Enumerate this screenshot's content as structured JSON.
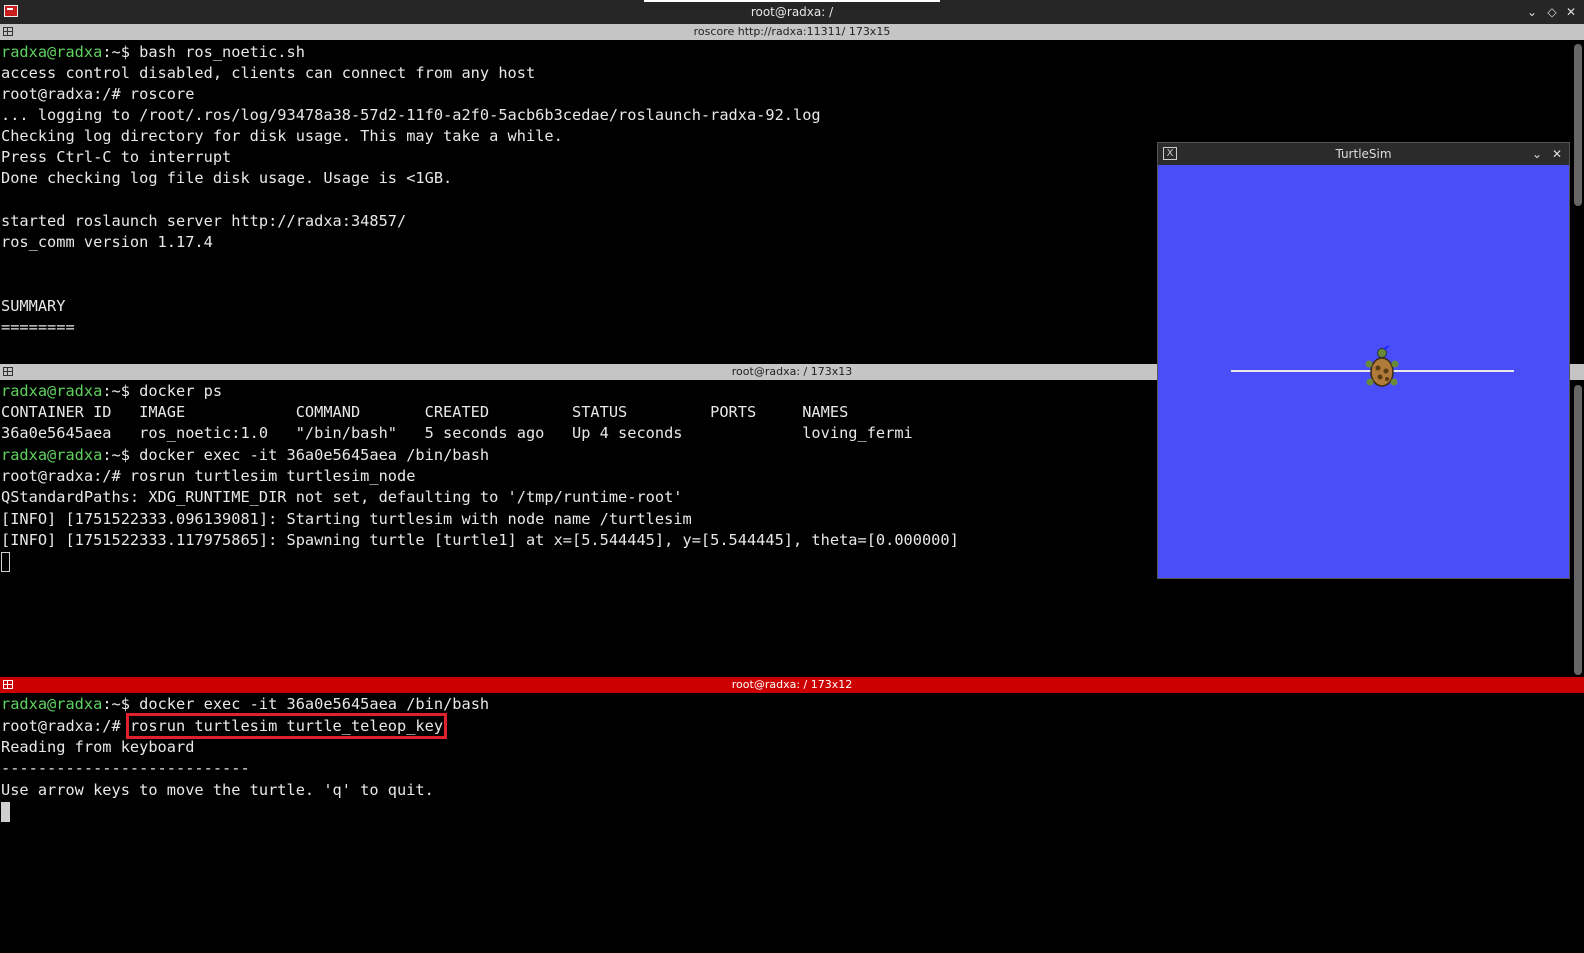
{
  "window": {
    "title": "root@radxa: /",
    "min_icon": "chevron-down-icon",
    "max_icon": "diamond-icon",
    "close_icon": "close-icon"
  },
  "panes": [
    {
      "title": "roscore http://radxa:11311/ 173x15",
      "lines": [
        {
          "user": "radxa@radxa",
          "rest": ":~$ bash ros_noetic.sh"
        },
        {
          "text": "access control disabled, clients can connect from any host"
        },
        {
          "text": "root@radxa:/# roscore"
        },
        {
          "text": "... logging to /root/.ros/log/93478a38-57d2-11f0-a2f0-5acb6b3cedae/roslaunch-radxa-92.log"
        },
        {
          "text": "Checking log directory for disk usage. This may take a while."
        },
        {
          "text": "Press Ctrl-C to interrupt"
        },
        {
          "text": "Done checking log file disk usage. Usage is <1GB."
        },
        {
          "text": ""
        },
        {
          "text": "started roslaunch server http://radxa:34857/"
        },
        {
          "text": "ros_comm version 1.17.4"
        },
        {
          "text": ""
        },
        {
          "text": ""
        },
        {
          "text": "SUMMARY"
        },
        {
          "text": "========"
        }
      ]
    },
    {
      "title": "root@radxa: / 173x13",
      "lines": [
        {
          "user": "radxa@radxa",
          "rest": ":~$ docker ps"
        },
        {
          "text": "CONTAINER ID   IMAGE            COMMAND       CREATED         STATUS         PORTS     NAMES"
        },
        {
          "text": "36a0e5645aea   ros_noetic:1.0   \"/bin/bash\"   5 seconds ago   Up 4 seconds             loving_fermi"
        },
        {
          "user": "radxa@radxa",
          "rest": ":~$ docker exec -it 36a0e5645aea /bin/bash"
        },
        {
          "text": "root@radxa:/# rosrun turtlesim turtlesim_node"
        },
        {
          "text": "QStandardPaths: XDG_RUNTIME_DIR not set, defaulting to '/tmp/runtime-root'"
        },
        {
          "text": "[INFO] [1751522333.096139081]: Starting turtlesim with node name /turtlesim"
        },
        {
          "text": "[INFO] [1751522333.117975865]: Spawning turtle [turtle1] at x=[5.544445], y=[5.544445], theta=[0.000000]"
        }
      ]
    },
    {
      "title": "root@radxa: / 173x12",
      "lines": [
        {
          "user": "radxa@radxa",
          "rest": ":~$ docker exec -it 36a0e5645aea /bin/bash"
        },
        {
          "prefix": "root@radxa:/# ",
          "highlighted": "rosrun turtlesim turtle_teleop_key"
        },
        {
          "text": "Reading from keyboard"
        },
        {
          "text": "---------------------------"
        },
        {
          "text": "Use arrow keys to move the turtle. 'q' to quit."
        }
      ]
    }
  ],
  "turtlesim": {
    "title": "TurtleSim",
    "background": "#4a4ef8",
    "trail_color": "#e8e8e8"
  },
  "colors": {
    "active_pane": "#cc0000",
    "prompt_user": "#5fd35f",
    "inactive_bar": "#c5c5c5"
  }
}
